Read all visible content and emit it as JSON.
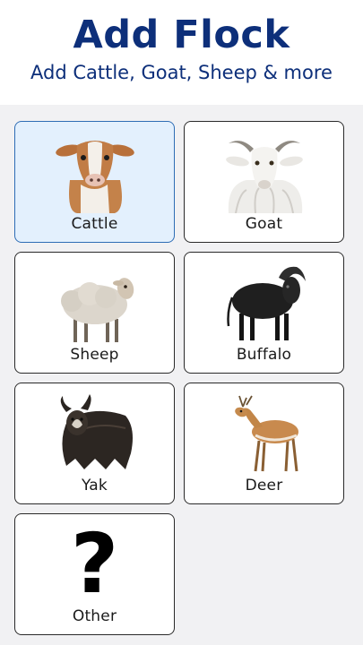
{
  "header": {
    "title": "Add Flock",
    "subtitle": "Add Cattle, Goat, Sheep & more"
  },
  "animals": [
    {
      "label": "Cattle",
      "icon": "cow-icon",
      "selected": true
    },
    {
      "label": "Goat",
      "icon": "goat-icon",
      "selected": false
    },
    {
      "label": "Sheep",
      "icon": "sheep-icon",
      "selected": false
    },
    {
      "label": "Buffalo",
      "icon": "buffalo-icon",
      "selected": false
    },
    {
      "label": "Yak",
      "icon": "yak-icon",
      "selected": false
    },
    {
      "label": "Deer",
      "icon": "deer-icon",
      "selected": false
    },
    {
      "label": "Other",
      "icon": "question-mark-icon",
      "glyph": "?",
      "selected": false
    }
  ],
  "colors": {
    "title": "#0d2f7a",
    "selected_bg": "#e3f0fd",
    "selected_border": "#2e6db5",
    "grid_bg": "#f1f1f3"
  }
}
